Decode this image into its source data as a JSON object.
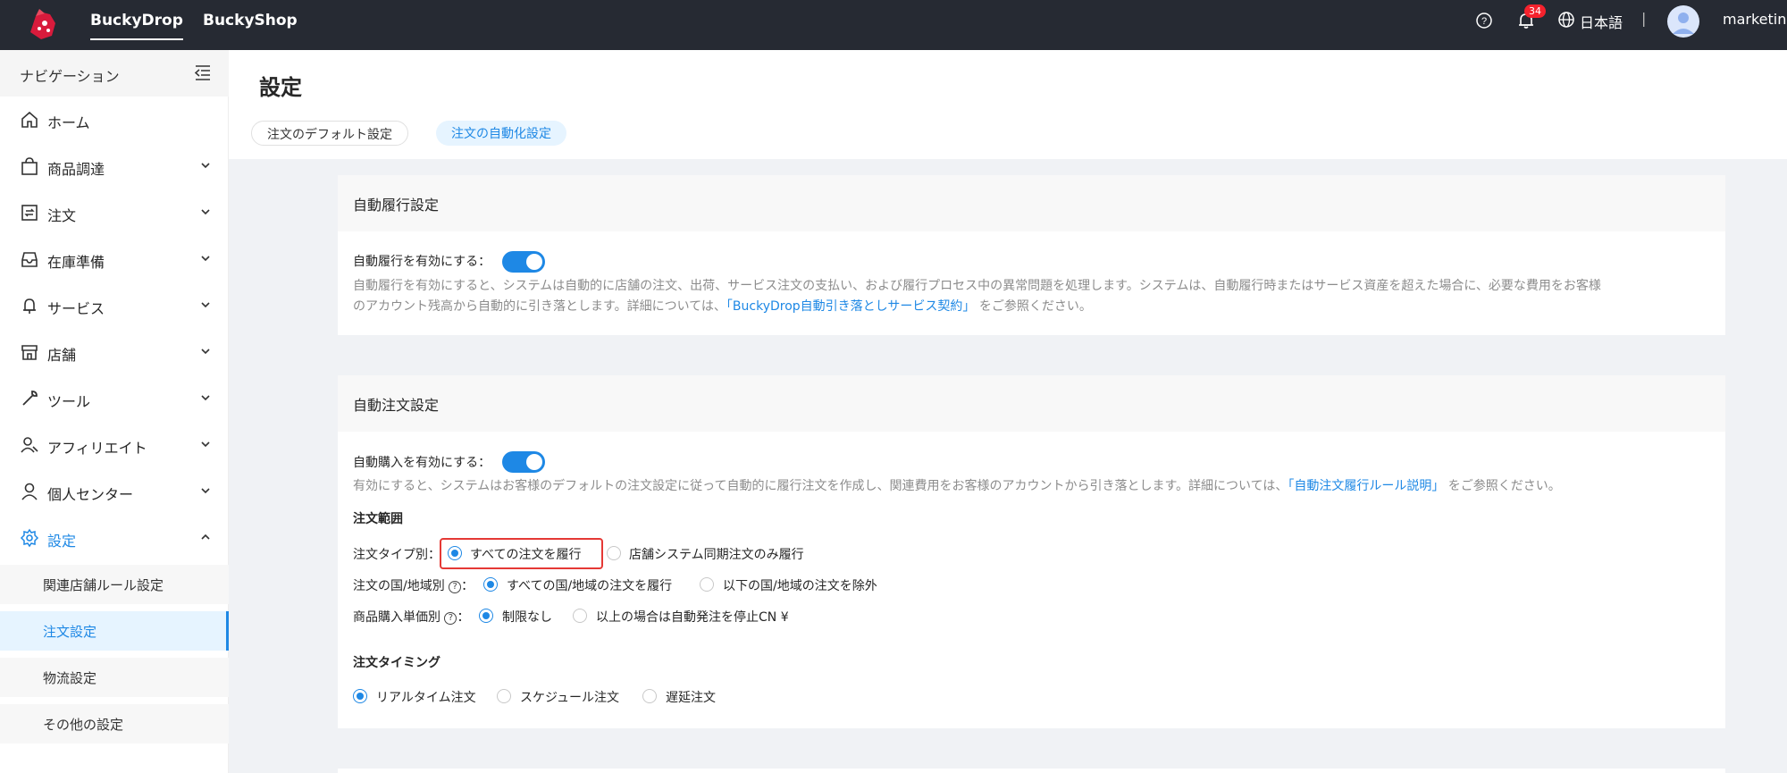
{
  "topbar": {
    "tabs": [
      "BuckyDrop",
      "BuckyShop"
    ],
    "notification_count": "34",
    "language": "日本語",
    "separator": "|",
    "username": "marketing"
  },
  "sidebar": {
    "title": "ナビゲーション",
    "items": [
      {
        "label": "ホーム",
        "icon": "home-icon"
      },
      {
        "label": "商品調達",
        "icon": "shopping-bag-icon"
      },
      {
        "label": "注文",
        "icon": "order-icon"
      },
      {
        "label": "在庫準備",
        "icon": "inbox-icon"
      },
      {
        "label": "サービス",
        "icon": "service-icon"
      },
      {
        "label": "店舗",
        "icon": "store-icon"
      },
      {
        "label": "ツール",
        "icon": "wrench-icon"
      },
      {
        "label": "アフィリエイト",
        "icon": "affiliate-icon"
      },
      {
        "label": "個人センター",
        "icon": "user-icon"
      },
      {
        "label": "設定",
        "icon": "gear-icon"
      }
    ],
    "sub_items": [
      "関連店舗ルール設定",
      "注文設定",
      "物流設定",
      "その他の設定"
    ]
  },
  "page": {
    "title": "設定",
    "tabs": [
      "注文のデフォルト設定",
      "注文の自動化設定"
    ]
  },
  "auto_fulfill": {
    "title": "自動履行設定",
    "toggle_label": "自動履行を有効にする：",
    "enabled": true,
    "desc_line1": "自動履行を有効にすると、システムは自動的に店舗の注文、出荷、サービス注文の支払い、および履行プロセス中の異常問題を処理します。システムは、自動履行時またはサービス資産を超えた場合に、必要な費用をお客様",
    "desc_line2_pre": "のアカウント残高から自動的に引き落とします。詳細については、",
    "desc_link": "「BuckyDrop自動引き落としサービス契約」",
    "desc_line2_post": " をご参照ください。"
  },
  "auto_order": {
    "title": "自動注文設定",
    "toggle_label": "自動購入を有効にする：",
    "enabled": true,
    "desc_pre": "有効にすると、システムはお客様のデフォルトの注文設定に従って自動的に履行注文を作成し、関連費用をお客様のアカウントから引き落とします。詳細については、",
    "desc_link": "「自動注文履行ルール説明」",
    "desc_post": " をご参照ください。",
    "scope_title": "注文範囲",
    "type_label": "注文タイプ別：",
    "type_options": [
      "すべての注文を履行",
      "店舗システム同期注文のみ履行"
    ],
    "country_label": "注文の国/地域別",
    "country_options": [
      "すべての国/地域の注文を履行",
      "以下の国/地域の注文を除外"
    ],
    "price_label": "商品購入単価別",
    "price_options": [
      "制限なし",
      "以上の場合は自動発注を停止CN ¥"
    ],
    "timing_title": "注文タイミング",
    "timing_options": [
      "リアルタイム注文",
      "スケジュール注文",
      "遅延注文"
    ]
  },
  "colors": {
    "accent": "#1e88e5",
    "topbar_bg": "#262a33",
    "highlight": "#e53935"
  }
}
